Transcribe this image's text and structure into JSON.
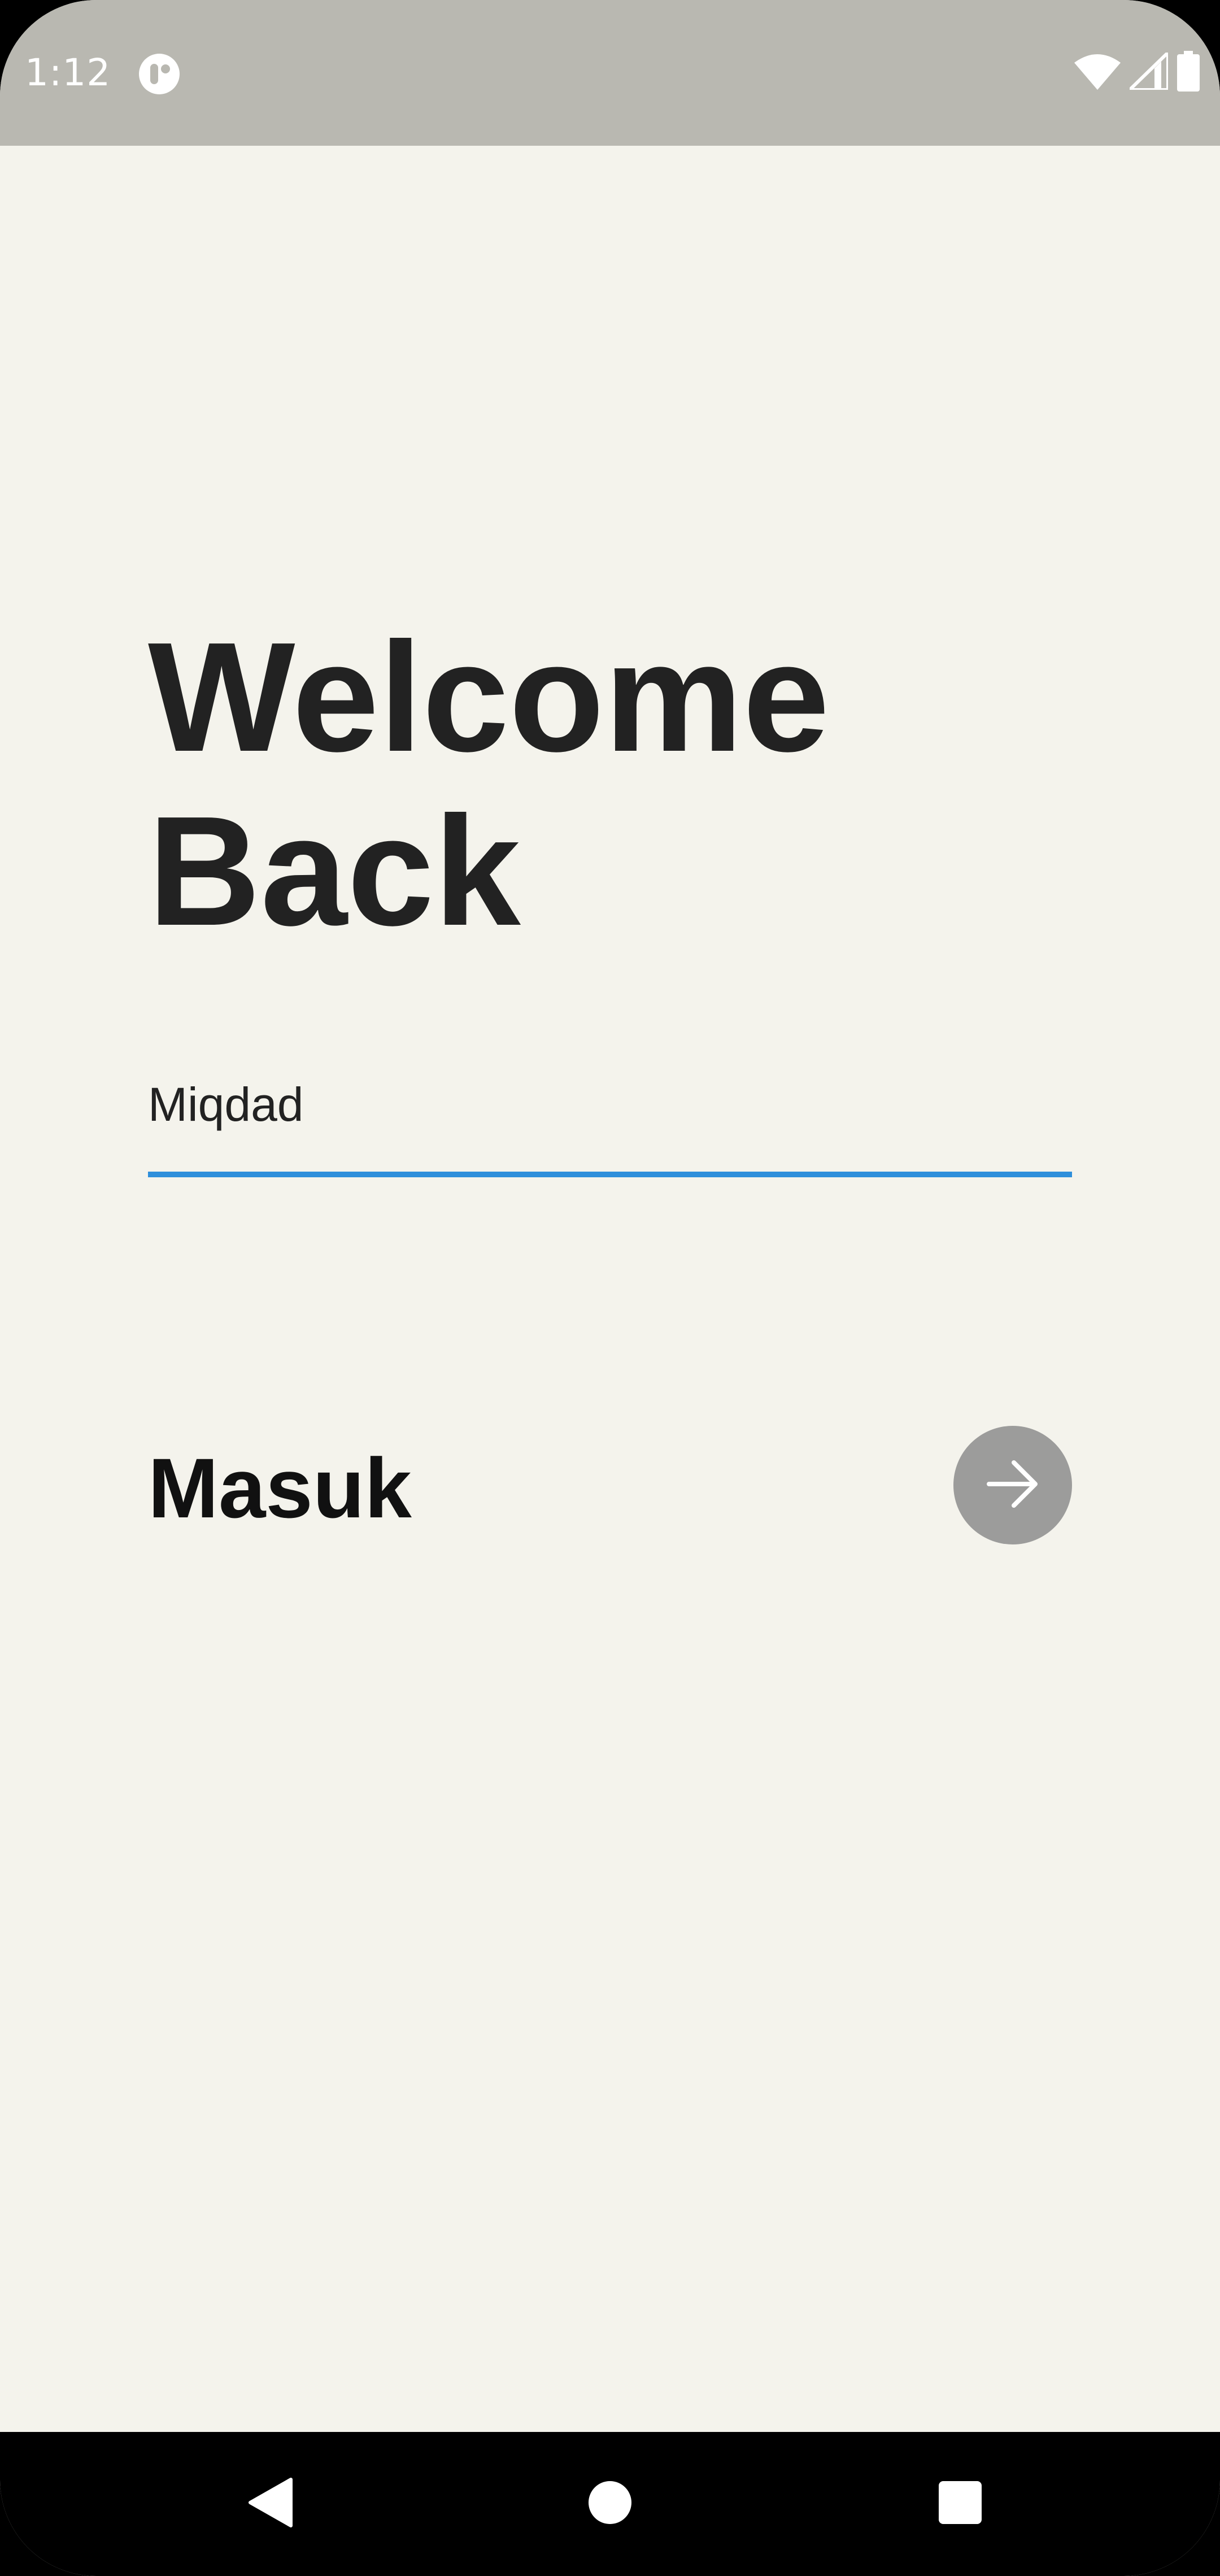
{
  "status_bar": {
    "time": "1:12",
    "icons": [
      "app-notification-icon",
      "wifi-icon",
      "cell-signal-icon",
      "battery-icon"
    ]
  },
  "title": {
    "line1": "Welcome",
    "line2": "Back"
  },
  "name_input": {
    "value": "Miqdad",
    "accent_color": "#2E8FDB"
  },
  "login": {
    "label": "Masuk",
    "button_icon": "arrow-right-icon",
    "button_color": "#9C9C9B"
  },
  "nav_bar": {
    "buttons": [
      "back-icon",
      "home-icon",
      "recents-icon"
    ]
  },
  "colors": {
    "background": "#F4F3EC",
    "status_bar": "#B9B8B1",
    "text": "#222222"
  }
}
